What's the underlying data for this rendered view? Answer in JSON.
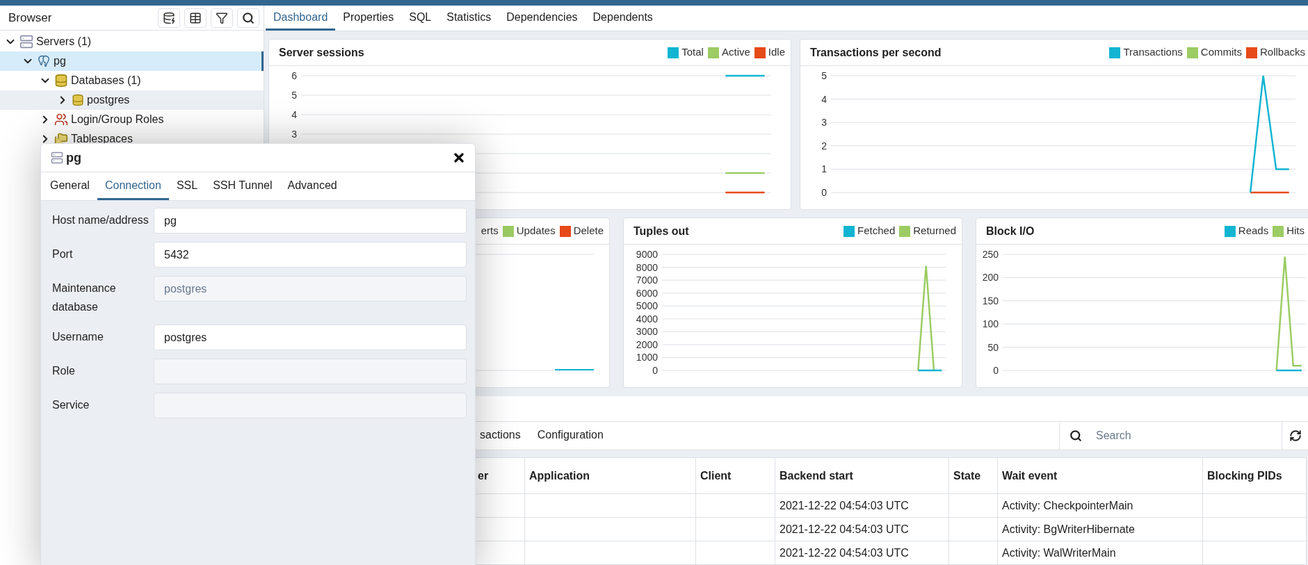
{
  "browser": {
    "title": "Browser",
    "tree": [
      {
        "label": "Servers (1)",
        "kind": "server-group",
        "expanded": true,
        "selected": false,
        "hovered": false,
        "children": [
          {
            "label": "pg",
            "kind": "server",
            "expanded": true,
            "selected": true,
            "hovered": false,
            "children": [
              {
                "label": "Databases (1)",
                "kind": "databases",
                "expanded": true,
                "selected": false,
                "hovered": false,
                "children": [
                  {
                    "label": "postgres",
                    "kind": "database",
                    "expanded": false,
                    "selected": false,
                    "hovered": true
                  }
                ]
              },
              {
                "label": "Login/Group Roles",
                "kind": "roles",
                "expanded": false,
                "selected": false,
                "hovered": false
              },
              {
                "label": "Tablespaces",
                "kind": "tablespaces",
                "expanded": false,
                "selected": false,
                "hovered": false
              }
            ]
          }
        ]
      }
    ]
  },
  "main_tabs": [
    {
      "label": "Dashboard",
      "selected": true
    },
    {
      "label": "Properties",
      "selected": false
    },
    {
      "label": "SQL",
      "selected": false
    },
    {
      "label": "Statistics",
      "selected": false
    },
    {
      "label": "Dependencies",
      "selected": false
    },
    {
      "label": "Dependents",
      "selected": false
    }
  ],
  "charts": [
    {
      "kind": "line",
      "chart_data": {
        "type": "line",
        "title": "Server sessions",
        "grid": true,
        "categories": [
          null,
          null,
          null,
          null,
          null,
          null,
          null,
          null,
          null,
          null,
          null,
          null,
          null,
          null,
          null,
          null,
          null,
          null,
          null,
          null,
          null,
          null,
          null,
          null,
          null,
          null,
          null,
          null,
          null,
          null,
          null,
          null,
          null,
          null,
          null,
          null
        ],
        "ylim": [
          0,
          6
        ],
        "yticks": [
          3,
          4,
          5,
          6
        ],
        "series": [
          {
            "name": "Total",
            "color": "#11b5d1",
            "values": [
              null,
              null,
              null,
              null,
              null,
              null,
              null,
              null,
              null,
              null,
              null,
              null,
              null,
              null,
              null,
              null,
              null,
              null,
              null,
              null,
              null,
              null,
              null,
              null,
              null,
              null,
              null,
              null,
              null,
              null,
              null,
              null,
              6,
              6,
              6,
              6
            ]
          },
          {
            "name": "Active",
            "color": "#9ccc63",
            "values": [
              null,
              null,
              null,
              null,
              null,
              null,
              null,
              null,
              null,
              null,
              null,
              null,
              null,
              null,
              null,
              null,
              null,
              null,
              null,
              null,
              null,
              null,
              null,
              null,
              null,
              null,
              null,
              null,
              null,
              null,
              null,
              null,
              1,
              1,
              1,
              1
            ]
          },
          {
            "name": "Idle",
            "color": "#e64a19",
            "values": [
              null,
              null,
              null,
              null,
              null,
              null,
              null,
              null,
              null,
              null,
              null,
              null,
              null,
              null,
              null,
              null,
              null,
              null,
              null,
              null,
              null,
              null,
              null,
              null,
              null,
              null,
              null,
              null,
              null,
              null,
              null,
              null,
              0,
              0,
              0,
              0
            ]
          }
        ]
      }
    },
    {
      "kind": "line",
      "chart_data": {
        "type": "line",
        "title": "Transactions per second",
        "grid": true,
        "categories": [
          null,
          null,
          null,
          null,
          null,
          null,
          null,
          null,
          null,
          null,
          null,
          null,
          null,
          null,
          null,
          null,
          null,
          null,
          null,
          null,
          null,
          null,
          null,
          null,
          null,
          null,
          null,
          null,
          null,
          null,
          null,
          null,
          null,
          null,
          null,
          null
        ],
        "ylim": [
          0,
          5
        ],
        "yticks": [
          0,
          1,
          2,
          3,
          4,
          5
        ],
        "series": [
          {
            "name": "Transactions",
            "color": "#11b5d1",
            "values": [
              null,
              null,
              null,
              null,
              null,
              null,
              null,
              null,
              null,
              null,
              null,
              null,
              null,
              null,
              null,
              null,
              null,
              null,
              null,
              null,
              null,
              null,
              null,
              null,
              null,
              null,
              null,
              null,
              null,
              null,
              null,
              null,
              0,
              5,
              1,
              1
            ]
          },
          {
            "name": "Commits",
            "color": "#9ccc63",
            "values": [
              null,
              null,
              null,
              null,
              null,
              null,
              null,
              null,
              null,
              null,
              null,
              null,
              null,
              null,
              null,
              null,
              null,
              null,
              null,
              null,
              null,
              null,
              null,
              null,
              null,
              null,
              null,
              null,
              null,
              null,
              null,
              null,
              null,
              null,
              null,
              null
            ]
          },
          {
            "name": "Rollbacks",
            "color": "#e64a19",
            "values": [
              null,
              null,
              null,
              null,
              null,
              null,
              null,
              null,
              null,
              null,
              null,
              null,
              null,
              null,
              null,
              null,
              null,
              null,
              null,
              null,
              null,
              null,
              null,
              null,
              null,
              null,
              null,
              null,
              null,
              null,
              null,
              null,
              0,
              0,
              0,
              0
            ]
          }
        ]
      }
    },
    {
      "kind": "picture",
      "legend": [
        {
          "name": "erts"
        },
        {
          "name": "Updates",
          "color": "#9ccc63"
        },
        {
          "name": "Delete",
          "color": "#e64a19"
        }
      ]
    },
    {
      "kind": "line",
      "chart_data": {
        "type": "line",
        "title": "Tuples out",
        "grid": true,
        "categories": [
          null,
          null,
          null,
          null,
          null,
          null,
          null,
          null,
          null,
          null,
          null,
          null,
          null,
          null,
          null,
          null,
          null,
          null,
          null,
          null,
          null,
          null,
          null,
          null,
          null,
          null,
          null,
          null,
          null,
          null,
          null,
          null,
          null,
          null,
          null,
          null
        ],
        "ylim": [
          0,
          9000
        ],
        "yticks": [
          0,
          1000,
          2000,
          3000,
          4000,
          5000,
          6000,
          7000,
          8000,
          9000
        ],
        "series": [
          {
            "name": "Fetched",
            "color": "#11b5d1",
            "values": [
              null,
              null,
              null,
              null,
              null,
              null,
              null,
              null,
              null,
              null,
              null,
              null,
              null,
              null,
              null,
              null,
              null,
              null,
              null,
              null,
              null,
              null,
              null,
              null,
              null,
              null,
              null,
              null,
              null,
              null,
              null,
              null,
              0,
              0,
              0,
              0
            ]
          },
          {
            "name": "Returned",
            "color": "#9ccc63",
            "values": [
              null,
              null,
              null,
              null,
              null,
              null,
              null,
              null,
              null,
              null,
              null,
              null,
              null,
              null,
              null,
              null,
              null,
              null,
              null,
              null,
              null,
              null,
              null,
              null,
              null,
              null,
              null,
              null,
              null,
              null,
              null,
              null,
              0,
              8100,
              0,
              null
            ]
          }
        ]
      }
    },
    {
      "kind": "line",
      "chart_data": {
        "type": "line",
        "title": "Block I/O",
        "grid": true,
        "categories": [
          null,
          null,
          null,
          null,
          null,
          null,
          null,
          null,
          null,
          null,
          null,
          null,
          null,
          null,
          null,
          null,
          null,
          null,
          null,
          null,
          null,
          null,
          null,
          null,
          null,
          null,
          null,
          null,
          null,
          null,
          null,
          null,
          null,
          null,
          null,
          null
        ],
        "ylim": [
          0,
          250
        ],
        "yticks": [
          0,
          50,
          100,
          150,
          200,
          250
        ],
        "series": [
          {
            "name": "Reads",
            "color": "#11b5d1",
            "values": [
              null,
              null,
              null,
              null,
              null,
              null,
              null,
              null,
              null,
              null,
              null,
              null,
              null,
              null,
              null,
              null,
              null,
              null,
              null,
              null,
              null,
              null,
              null,
              null,
              null,
              null,
              null,
              null,
              null,
              null,
              null,
              null,
              0,
              0,
              0,
              0
            ]
          },
          {
            "name": "Hits",
            "color": "#9ccc63",
            "values": [
              null,
              null,
              null,
              null,
              null,
              null,
              null,
              null,
              null,
              null,
              null,
              null,
              null,
              null,
              null,
              null,
              null,
              null,
              null,
              null,
              null,
              null,
              null,
              null,
              null,
              null,
              null,
              null,
              null,
              null,
              null,
              null,
              0,
              245,
              10,
              10
            ]
          }
        ]
      }
    }
  ],
  "activity": {
    "tabs": [
      {
        "label": "sactions",
        "selected": false
      },
      {
        "label": "Configuration",
        "selected": false
      }
    ],
    "search": {
      "placeholder": "Search"
    },
    "columns": [
      "er",
      "Application",
      "Client",
      "Backend start",
      "State",
      "Wait event",
      "Blocking PIDs"
    ],
    "rows": [
      [
        null,
        null,
        null,
        "2021-12-22 04:54:03 UTC",
        null,
        "Activity: CheckpointerMain",
        null
      ],
      [
        null,
        null,
        null,
        "2021-12-22 04:54:03 UTC",
        null,
        "Activity: BgWriterHibernate",
        null
      ],
      [
        null,
        null,
        null,
        "2021-12-22 04:54:03 UTC",
        null,
        "Activity: WalWriterMain",
        null
      ]
    ]
  },
  "dialog": {
    "title": "pg",
    "tabs": [
      {
        "label": "General",
        "selected": false
      },
      {
        "label": "Connection",
        "selected": true
      },
      {
        "label": "SSL",
        "selected": false
      },
      {
        "label": "SSH Tunnel",
        "selected": false
      },
      {
        "label": "Advanced",
        "selected": false
      }
    ],
    "fields": [
      {
        "label": "Host name/address",
        "value": "pg",
        "disabled": false
      },
      {
        "label": "Port",
        "value": "5432",
        "disabled": false
      },
      {
        "label": "Maintenance database",
        "value": "postgres",
        "disabled": true
      },
      {
        "label": "Username",
        "value": "postgres",
        "disabled": false
      },
      {
        "label": "Role",
        "disabled": true
      },
      {
        "label": "Service",
        "disabled": true
      }
    ]
  }
}
